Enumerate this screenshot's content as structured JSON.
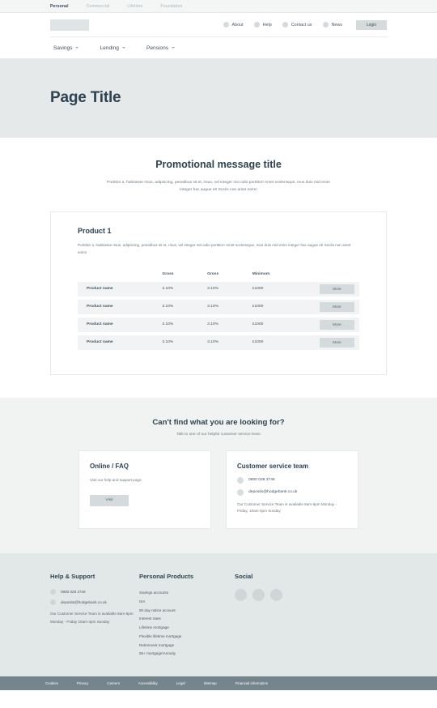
{
  "utility_nav": {
    "tabs": [
      {
        "label": "Personal",
        "active": true
      },
      {
        "label": "Commercial",
        "active": false
      },
      {
        "label": "Lifetime",
        "active": false
      },
      {
        "label": "Foundation",
        "active": false
      }
    ]
  },
  "header": {
    "logo_alt": "logo-placeholder",
    "links": [
      {
        "label": "About",
        "icon": "circle-icon"
      },
      {
        "label": "Help",
        "icon": "circle-icon"
      },
      {
        "label": "Contact us",
        "icon": "circle-icon"
      },
      {
        "label": "News",
        "icon": "circle-icon"
      }
    ],
    "login_label": "Login",
    "nav": [
      {
        "label": "Savings",
        "icon": "chevron-down-icon"
      },
      {
        "label": "Lending",
        "icon": "chevron-down-icon"
      },
      {
        "label": "Pensions",
        "icon": "chevron-down-icon"
      }
    ]
  },
  "hero": {
    "title": "Page Title"
  },
  "promo": {
    "title": "Promotional message title",
    "body": "Porttitor a, habitasse risus, adipiscing, penatibus sit et, risus, vel integer nisi odio porttitor! Amet scelerisque, mus duis mid enim integer hac augue et! Sociis non amet enim!"
  },
  "product": {
    "title": "Product 1",
    "description": "Porttitor a, habitasse risus, adipiscing, penatibus sit et, risus, vel integer nisi odio porttitor! Amet scelerisque, mus duis mid enim integer hac augue et! Sociis non amet enim!",
    "columns": [
      "",
      "Gross",
      "Gross",
      "Minimum",
      ""
    ],
    "rows": [
      {
        "name": "Product name",
        "gross1": "3.10%",
        "gross2": "3.10%",
        "minimum": "£1000",
        "action": "More"
      },
      {
        "name": "Product name",
        "gross1": "3.10%",
        "gross2": "3.10%",
        "minimum": "£1000",
        "action": "More"
      },
      {
        "name": "Product name",
        "gross1": "3.10%",
        "gross2": "3.10%",
        "minimum": "£1000",
        "action": "More"
      },
      {
        "name": "Product name",
        "gross1": "3.10%",
        "gross2": "3.10%",
        "minimum": "£1000",
        "action": "More"
      }
    ]
  },
  "help": {
    "title": "Can't find what you are looking for?",
    "subtitle": "Talk to one of our helpful customer service team",
    "card_faq": {
      "title": "Online / FAQ",
      "text": "Visit our help and support page.",
      "button_label": "Visit"
    },
    "card_service": {
      "title": "Customer service team",
      "phone": "0800 028 3746",
      "email": "deposits@hodgebank.co.uk",
      "note": "Our Customer Service Team is available 8am-8pm Monday - Friday, 10am-4pm Sunday"
    }
  },
  "footer": {
    "help": {
      "heading": "Help & Support",
      "phone": "0800 028 3746",
      "email": "deposits@hodgebank.co.uk",
      "note": "Our Customer Service Team is available 8am-8pm Monday - Friday 10am-4pm Sunday"
    },
    "products": {
      "heading": "Personal Products",
      "links": [
        "Savings accounts",
        "ISA",
        "90 day notice account",
        "Interest rates",
        "Lifetime mortgage",
        "Flexible lifetime mortgage",
        "Retirement mortgage",
        "55+ mortgage\\Annuity"
      ]
    },
    "social": {
      "heading": "Social",
      "icons": [
        "social-icon-1",
        "social-icon-2",
        "social-icon-3"
      ]
    }
  },
  "bottom_bar": {
    "links": [
      "Cookies",
      "Privacy",
      "Careers",
      "Accessibility",
      "Legal",
      "Sitemap",
      "Financial information"
    ]
  },
  "colors": {
    "hero_bg": "#e5e9ea",
    "footer_bg": "#e2e7e8",
    "bottom_bar_bg": "#74858c",
    "button_bg": "#d5dbdd",
    "heading": "#2e4250",
    "body_text": "#6b7a83",
    "row_bg": "#f1f3f4"
  }
}
